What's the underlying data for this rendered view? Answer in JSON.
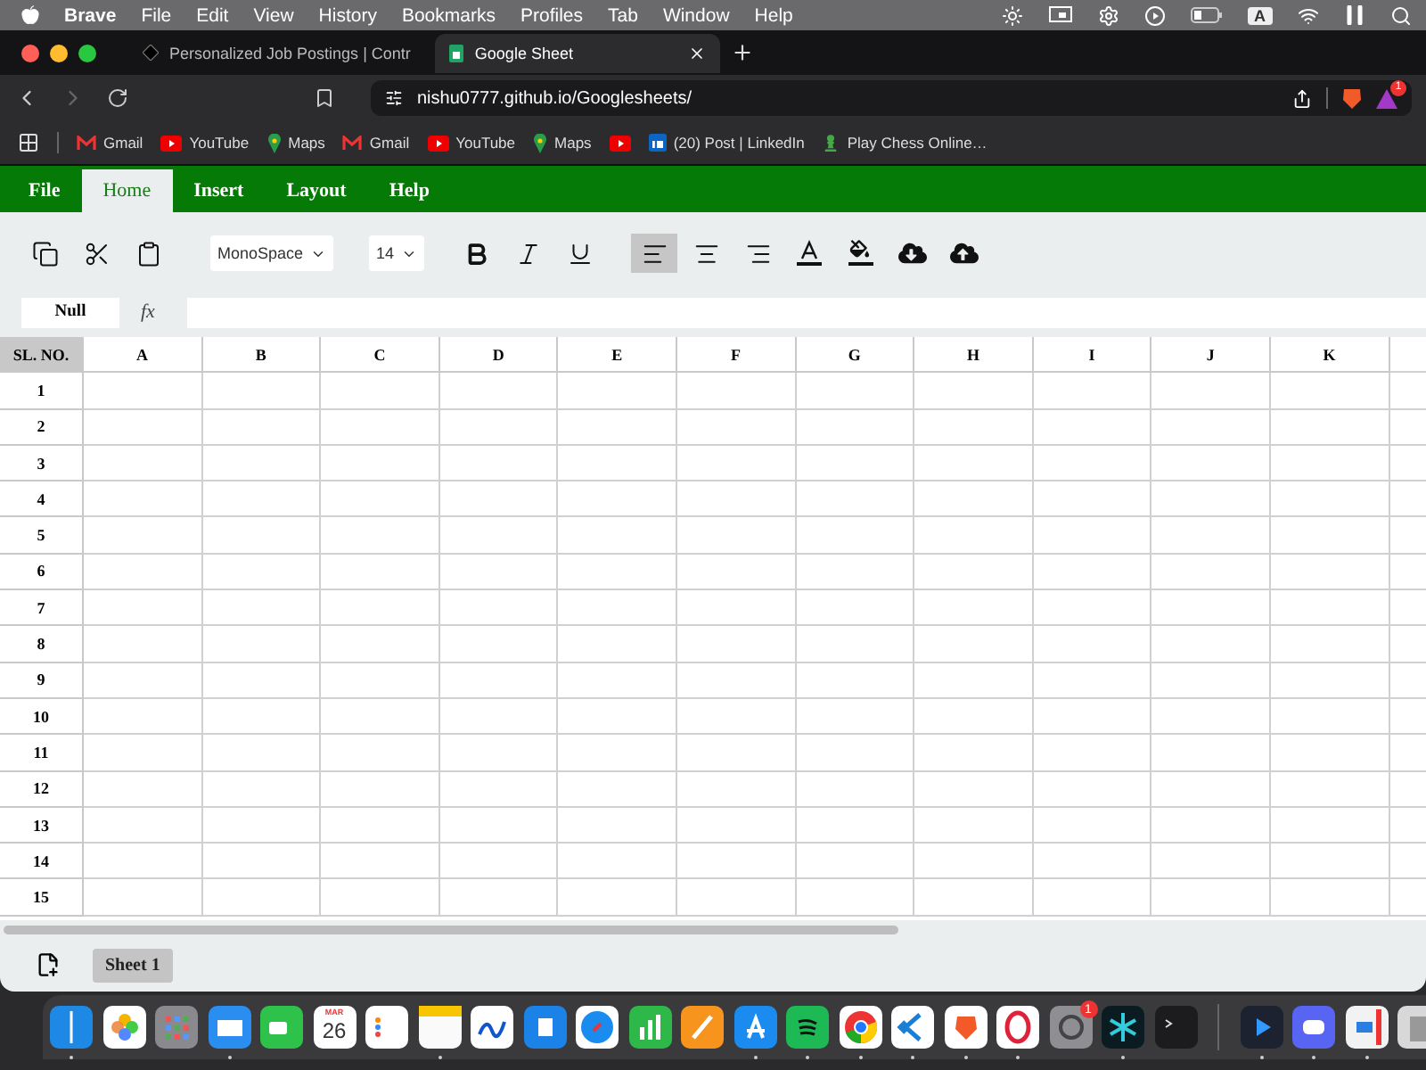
{
  "menu_bar": {
    "app": "Brave",
    "items": [
      "File",
      "Edit",
      "View",
      "History",
      "Bookmarks",
      "Profiles",
      "Tab",
      "Window",
      "Help"
    ],
    "input_source": "A"
  },
  "browser": {
    "tabs": [
      {
        "title": "Personalized Job Postings | Contr",
        "selected": false
      },
      {
        "title": "Google Sheet",
        "selected": true
      }
    ],
    "url": "nishu0777.github.io/Googlesheets/",
    "extension_badge": "1",
    "bookmarks": [
      {
        "kind": "gmail",
        "label": "Gmail"
      },
      {
        "kind": "youtube",
        "label": "YouTube"
      },
      {
        "kind": "maps",
        "label": "Maps"
      },
      {
        "kind": "gmail",
        "label": "Gmail"
      },
      {
        "kind": "youtube",
        "label": "YouTube"
      },
      {
        "kind": "maps",
        "label": "Maps"
      },
      {
        "kind": "youtube"
      },
      {
        "kind": "linkedin",
        "label": "(20) Post | LinkedIn"
      },
      {
        "kind": "chess",
        "label": "Play Chess Online…"
      }
    ]
  },
  "sheet_app": {
    "menu": [
      {
        "label": "File",
        "selected": false
      },
      {
        "label": "Home",
        "selected": true
      },
      {
        "label": "Insert",
        "selected": false
      },
      {
        "label": "Layout",
        "selected": false
      },
      {
        "label": "Help",
        "selected": false
      }
    ],
    "tools": [
      {
        "kind": "copy",
        "selected": false
      },
      {
        "kind": "cut",
        "selected": false
      },
      {
        "kind": "paste",
        "selected": false
      },
      {
        "kind": "font",
        "value": "MonoSpace"
      },
      {
        "kind": "size",
        "value": "14"
      },
      {
        "kind": "bold",
        "selected": false
      },
      {
        "kind": "italic",
        "selected": false
      },
      {
        "kind": "underline",
        "selected": false
      },
      {
        "kind": "align_left",
        "selected": true
      },
      {
        "kind": "align_center",
        "selected": false
      },
      {
        "kind": "align_right",
        "selected": false
      },
      {
        "kind": "text_color",
        "selected": false
      },
      {
        "kind": "fill_color",
        "selected": false
      },
      {
        "kind": "download",
        "selected": false
      },
      {
        "kind": "upload",
        "selected": false
      }
    ],
    "formula_bar": {
      "cell": "Null",
      "label": "fx"
    },
    "grid": {
      "corner": "SL. NO.",
      "columns": [
        "A",
        "B",
        "C",
        "D",
        "E",
        "F",
        "G",
        "H",
        "I",
        "J",
        "K"
      ],
      "rows": [
        "1",
        "2",
        "3",
        "4",
        "5",
        "6",
        "7",
        "8",
        "9",
        "10",
        "11",
        "12",
        "13",
        "14",
        "15"
      ]
    },
    "sheets": [
      {
        "label": "Sheet 1",
        "selected": true
      }
    ]
  },
  "dock": {
    "calendar_month": "MAR",
    "calendar_day": "26",
    "settings_badge": "1",
    "apps": [
      {
        "kind": "finder",
        "running": true
      },
      {
        "kind": "photos",
        "running": false
      },
      {
        "kind": "launchpad",
        "running": false
      },
      {
        "kind": "mail",
        "running": true
      },
      {
        "kind": "facetime",
        "running": false
      },
      {
        "kind": "calendar",
        "running": false
      },
      {
        "kind": "reminders",
        "running": false
      },
      {
        "kind": "notes",
        "running": true
      },
      {
        "kind": "freeform",
        "running": false
      },
      {
        "kind": "keynote",
        "running": false
      },
      {
        "kind": "safari",
        "running": false
      },
      {
        "kind": "numbers",
        "running": false
      },
      {
        "kind": "pages",
        "running": false
      },
      {
        "kind": "appstore",
        "running": true
      },
      {
        "kind": "spotify",
        "running": true
      },
      {
        "kind": "chrome",
        "running": true
      },
      {
        "kind": "vscode",
        "running": true
      },
      {
        "kind": "brave",
        "running": true
      },
      {
        "kind": "opera",
        "running": true
      },
      {
        "kind": "settings",
        "running": false
      },
      {
        "kind": "crystal",
        "running": true
      },
      {
        "kind": "terminal",
        "running": false
      },
      {
        "kind": "divider"
      },
      {
        "kind": "player",
        "running": true
      },
      {
        "kind": "discord",
        "running": true
      },
      {
        "kind": "remote",
        "running": true
      },
      {
        "kind": "trash",
        "running": false
      }
    ]
  }
}
